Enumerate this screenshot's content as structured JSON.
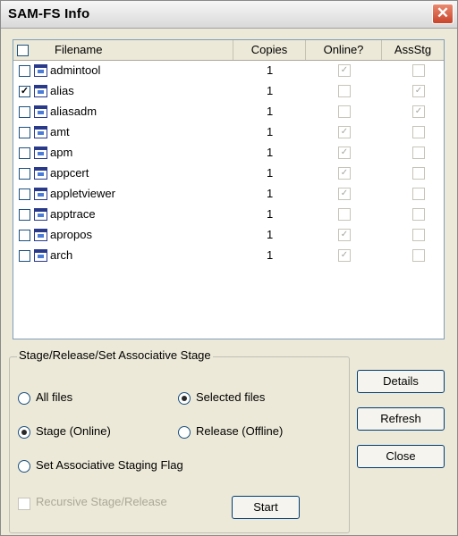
{
  "window": {
    "title": "SAM-FS Info",
    "close_glyph": "✕"
  },
  "list": {
    "headers": {
      "filename": "Filename",
      "copies": "Copies",
      "online": "Online?",
      "assstg": "AssStg"
    },
    "rows": [
      {
        "name": "admintool",
        "copies": "1",
        "selected": false,
        "online": true,
        "assstg": false
      },
      {
        "name": "alias",
        "copies": "1",
        "selected": true,
        "online": false,
        "assstg": true
      },
      {
        "name": "aliasadm",
        "copies": "1",
        "selected": false,
        "online": false,
        "assstg": true
      },
      {
        "name": "amt",
        "copies": "1",
        "selected": false,
        "online": true,
        "assstg": false
      },
      {
        "name": "apm",
        "copies": "1",
        "selected": false,
        "online": true,
        "assstg": false
      },
      {
        "name": "appcert",
        "copies": "1",
        "selected": false,
        "online": true,
        "assstg": false
      },
      {
        "name": "appletviewer",
        "copies": "1",
        "selected": false,
        "online": true,
        "assstg": false
      },
      {
        "name": "apptrace",
        "copies": "1",
        "selected": false,
        "online": false,
        "assstg": false
      },
      {
        "name": "apropos",
        "copies": "1",
        "selected": false,
        "online": true,
        "assstg": false
      },
      {
        "name": "arch",
        "copies": "1",
        "selected": false,
        "online": true,
        "assstg": false
      }
    ]
  },
  "options": {
    "group_title": "Stage/Release/Set Associative Stage",
    "all_files": "All files",
    "selected_files": "Selected files",
    "stage_online": "Stage (Online)",
    "release_offline": "Release (Offline)",
    "set_assoc_flag": "Set Associative Staging Flag",
    "recursive": "Recursive Stage/Release",
    "start": "Start",
    "file_scope": "selected",
    "action": "stage"
  },
  "buttons": {
    "details": "Details",
    "refresh": "Refresh",
    "close": "Close"
  },
  "colors": {
    "accent": "#003c74",
    "close_red": "#c8442a",
    "face": "#ece9d8"
  }
}
